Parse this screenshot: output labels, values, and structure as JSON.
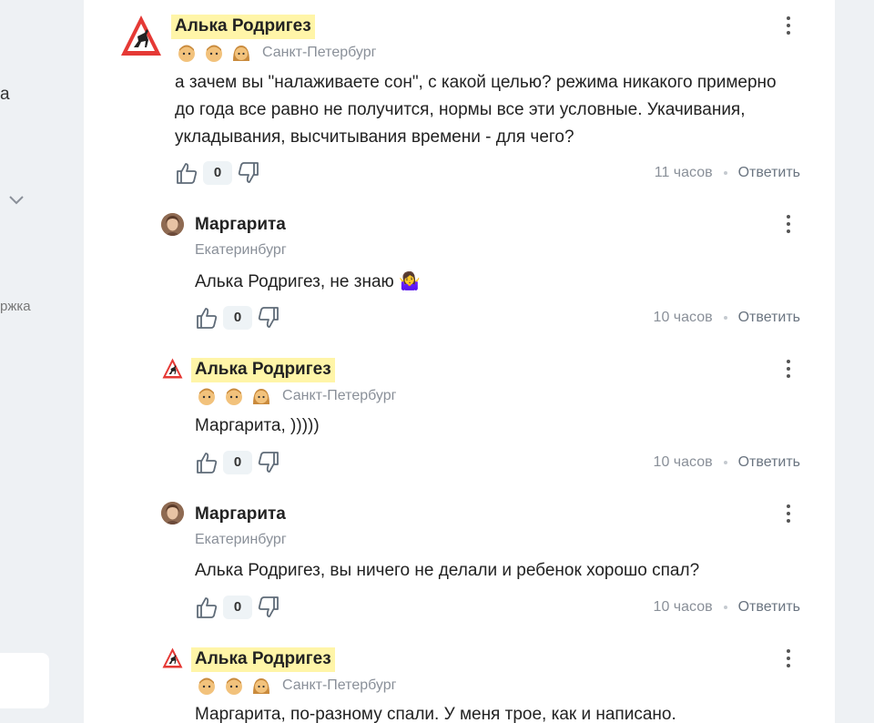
{
  "sidebar": {
    "partial_item_1": "а",
    "partial_item_support": "ржка"
  },
  "comments": [
    {
      "author": "Алька Родригез",
      "city": "Санкт-Петербург",
      "avatar": "warning-sign-deer",
      "text": "а зачем вы \"налаживаете сон\", с какой целью? режима никакого примерно до года все равно не получится, нормы все эти условные. Укачивания, укладывания, высчитывания времени - для чего?",
      "likes": "0",
      "time": "11 часов",
      "reply": "Ответить"
    },
    {
      "author": "Маргарита",
      "city": "Екатеринбург",
      "avatar": "photo",
      "text": "Алька Родригез, не знаю 🤷‍♀️",
      "likes": "0",
      "time": "10 часов",
      "reply": "Ответить"
    },
    {
      "author": "Алька Родригез",
      "city": "Санкт-Петербург",
      "avatar": "warning-sign-deer",
      "text": "Маргарита, )))))",
      "likes": "0",
      "time": "10 часов",
      "reply": "Ответить"
    },
    {
      "author": "Маргарита",
      "city": "Екатеринбург",
      "avatar": "photo",
      "text": "Алька Родригез, вы ничего не делали и ребенок хорошо спал?",
      "likes": "0",
      "time": "10 часов",
      "reply": "Ответить"
    },
    {
      "author": "Алька Родригез",
      "city": "Санкт-Петербург",
      "avatar": "warning-sign-deer",
      "text": "Маргарита, по-разному спали. У меня трое, как и написано.",
      "likes": "",
      "time": "",
      "reply": ""
    }
  ],
  "colors": {
    "name_highlight": "#fff5a8",
    "page_bg": "#eef1f4",
    "muted_text": "#8a9099"
  }
}
